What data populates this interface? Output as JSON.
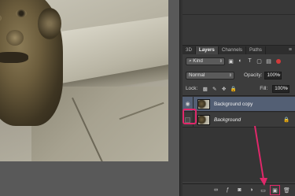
{
  "panel": {
    "tabs": [
      {
        "label": "3D"
      },
      {
        "label": "Layers"
      },
      {
        "label": "Channels"
      },
      {
        "label": "Paths"
      }
    ],
    "menu_icon": "≡",
    "filter": {
      "kind_label": "Kind",
      "search_icon": "search-icon"
    },
    "blend_mode": "Normal",
    "opacity_label": "Opacity:",
    "opacity_value": "100%",
    "lock_label": "Lock:",
    "fill_label": "Fill:",
    "fill_value": "100%",
    "layers": [
      {
        "name": "Background copy",
        "visible": true,
        "selected": true
      },
      {
        "name": "Background",
        "visible": false,
        "locked": true
      }
    ]
  },
  "colors": {
    "annotation": "#e0286a",
    "selected_layer": "#535f74"
  }
}
